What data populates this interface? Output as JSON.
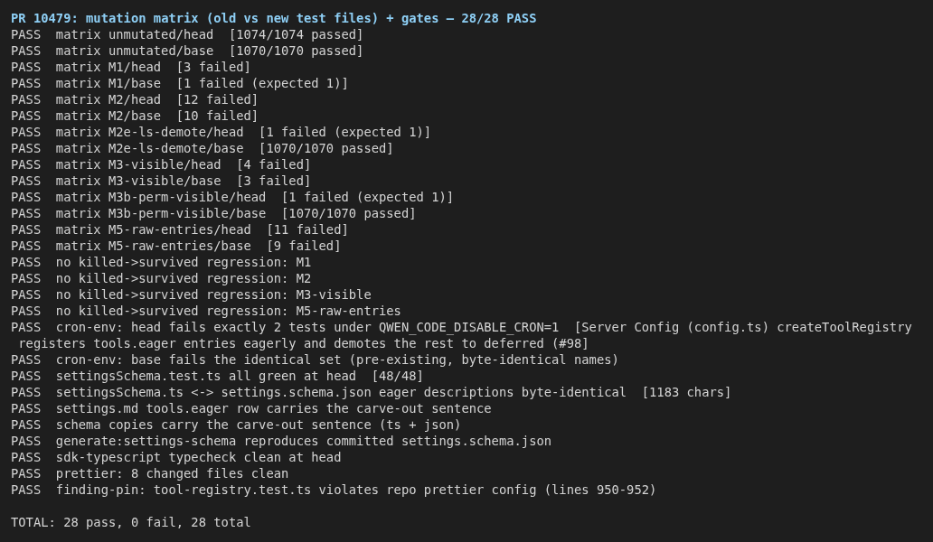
{
  "title": "PR 10479: mutation matrix (old vs new test files) + gates — 28/28 PASS",
  "results": [
    {
      "status": "PASS",
      "text": "matrix unmutated/head  [1074/1074 passed]"
    },
    {
      "status": "PASS",
      "text": "matrix unmutated/base  [1070/1070 passed]"
    },
    {
      "status": "PASS",
      "text": "matrix M1/head  [3 failed]"
    },
    {
      "status": "PASS",
      "text": "matrix M1/base  [1 failed (expected 1)]"
    },
    {
      "status": "PASS",
      "text": "matrix M2/head  [12 failed]"
    },
    {
      "status": "PASS",
      "text": "matrix M2/base  [10 failed]"
    },
    {
      "status": "PASS",
      "text": "matrix M2e-ls-demote/head  [1 failed (expected 1)]"
    },
    {
      "status": "PASS",
      "text": "matrix M2e-ls-demote/base  [1070/1070 passed]"
    },
    {
      "status": "PASS",
      "text": "matrix M3-visible/head  [4 failed]"
    },
    {
      "status": "PASS",
      "text": "matrix M3-visible/base  [3 failed]"
    },
    {
      "status": "PASS",
      "text": "matrix M3b-perm-visible/head  [1 failed (expected 1)]"
    },
    {
      "status": "PASS",
      "text": "matrix M3b-perm-visible/base  [1070/1070 passed]"
    },
    {
      "status": "PASS",
      "text": "matrix M5-raw-entries/head  [11 failed]"
    },
    {
      "status": "PASS",
      "text": "matrix M5-raw-entries/base  [9 failed]"
    },
    {
      "status": "PASS",
      "text": "no killed->survived regression: M1"
    },
    {
      "status": "PASS",
      "text": "no killed->survived regression: M2"
    },
    {
      "status": "PASS",
      "text": "no killed->survived regression: M3-visible"
    },
    {
      "status": "PASS",
      "text": "no killed->survived regression: M5-raw-entries"
    },
    {
      "status": "PASS",
      "text": "cron-env: head fails exactly 2 tests under QWEN_CODE_DISABLE_CRON=1  [Server Config (config.ts) createToolRegistry",
      "continuation": "registers tools.eager entries eagerly and demotes the rest to deferred (#98]"
    },
    {
      "status": "PASS",
      "text": "cron-env: base fails the identical set (pre-existing, byte-identical names)"
    },
    {
      "status": "PASS",
      "text": "settingsSchema.test.ts all green at head  [48/48]"
    },
    {
      "status": "PASS",
      "text": "settingsSchema.ts <-> settings.schema.json eager descriptions byte-identical  [1183 chars]"
    },
    {
      "status": "PASS",
      "text": "settings.md tools.eager row carries the carve-out sentence"
    },
    {
      "status": "PASS",
      "text": "schema copies carry the carve-out sentence (ts + json)"
    },
    {
      "status": "PASS",
      "text": "generate:settings-schema reproduces committed settings.schema.json"
    },
    {
      "status": "PASS",
      "text": "sdk-typescript typecheck clean at head"
    },
    {
      "status": "PASS",
      "text": "prettier: 8 changed files clean"
    },
    {
      "status": "PASS",
      "text": "finding-pin: tool-registry.test.ts violates repo prettier config (lines 950-952)"
    }
  ],
  "total": "TOTAL: 28 pass, 0 fail, 28 total"
}
